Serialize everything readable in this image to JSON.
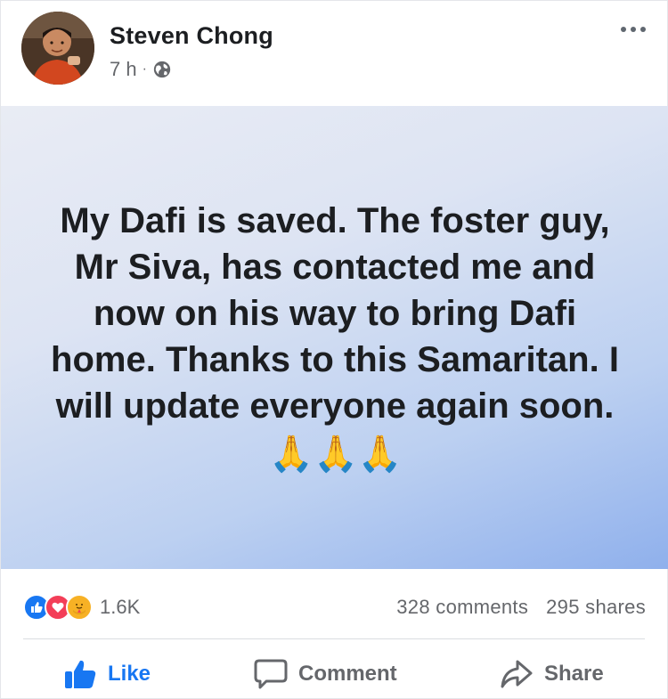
{
  "post": {
    "author": "Steven Chong",
    "time": "7 h",
    "separator": "·",
    "status_text": "My Dafi is saved. The foster guy, Mr Siva, has contacted me and now on his way to bring Dafi home. Thanks to this Samaritan. I will update everyone again soon.",
    "status_emoji": "🙏🙏🙏",
    "status_background": [
      "#e9ecf4",
      "#8fb0ec"
    ]
  },
  "reactions": {
    "icons": [
      "like-icon",
      "love-icon",
      "care-icon"
    ],
    "count": "1.6K"
  },
  "stats": {
    "comments": "328 comments",
    "shares": "295 shares"
  },
  "actions": {
    "like": "Like",
    "comment": "Comment",
    "share": "Share"
  },
  "colors": {
    "accent": "#1877f2",
    "love": "#f33e58",
    "care": "#f7b125",
    "muted": "#65676b"
  }
}
